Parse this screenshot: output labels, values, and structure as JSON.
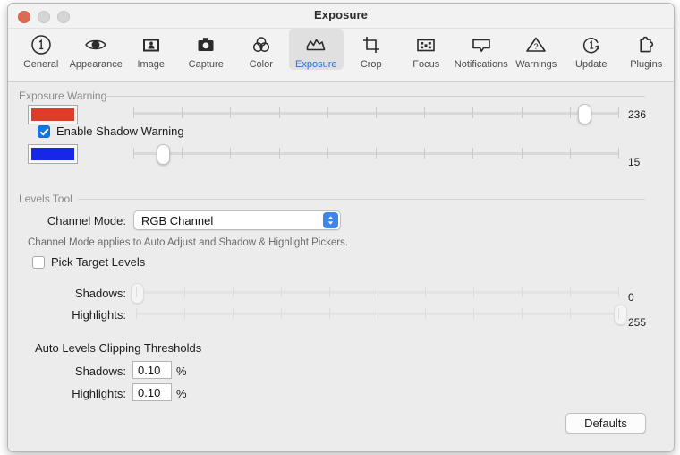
{
  "window": {
    "title": "Exposure",
    "controls": [
      {
        "name": "close",
        "label": "Close"
      },
      {
        "name": "minimize",
        "label": "Minimize"
      },
      {
        "name": "zoom",
        "label": "Zoom"
      }
    ]
  },
  "toolbar": {
    "selected": "Exposure",
    "items": [
      {
        "label": "General",
        "icon": "circled-one-icon"
      },
      {
        "label": "Appearance",
        "icon": "eye-icon"
      },
      {
        "label": "Image",
        "icon": "picture-frame-icon"
      },
      {
        "label": "Capture",
        "icon": "camera-icon"
      },
      {
        "label": "Color",
        "icon": "color-circles-icon"
      },
      {
        "label": "Exposure",
        "icon": "histogram-icon"
      },
      {
        "label": "Crop",
        "icon": "crop-icon"
      },
      {
        "label": "Focus",
        "icon": "focus-grid-icon"
      },
      {
        "label": "Notifications",
        "icon": "speech-bubble-icon"
      },
      {
        "label": "Warnings",
        "icon": "warning-triangle-icon"
      },
      {
        "label": "Update",
        "icon": "refresh-one-icon"
      },
      {
        "label": "Plugins",
        "icon": "puzzle-piece-icon"
      }
    ]
  },
  "exposure_warning": {
    "group_title": "Exposure Warning",
    "highlight_color": "#dc3c28",
    "highlight_slider": {
      "value": 236,
      "min": 0,
      "max": 255,
      "ticks": 11,
      "enabled": true
    },
    "shadow_checkbox": {
      "label": "Enable Shadow Warning",
      "checked": true
    },
    "shadow_color": "#1528e8",
    "shadow_slider": {
      "value": 15,
      "min": 0,
      "max": 255,
      "ticks": 11,
      "enabled": true
    }
  },
  "levels_tool": {
    "group_title": "Levels Tool",
    "channel_mode_label": "Channel Mode:",
    "channel_mode_value": "RGB Channel",
    "channel_mode_options": [
      "RGB Channel"
    ],
    "note": "Channel Mode applies to Auto Adjust and Shadow & Highlight Pickers.",
    "pick_target_levels": {
      "label": "Pick Target Levels",
      "checked": false
    },
    "shadows_label": "Shadows:",
    "shadows_slider": {
      "value": 0,
      "min": 0,
      "max": 255,
      "ticks": 11,
      "enabled": false
    },
    "shadows_value_text": "0",
    "highlights_label": "Highlights:",
    "highlights_slider": {
      "value": 255,
      "min": 0,
      "max": 255,
      "ticks": 11,
      "enabled": false
    },
    "highlights_value_text": "255"
  },
  "auto_levels": {
    "group_title": "Auto Levels Clipping Thresholds",
    "shadows_label": "Shadows:",
    "shadows_value": "0.10",
    "shadows_unit": "%",
    "highlights_label": "Highlights:",
    "highlights_value": "0.10",
    "highlights_unit": "%"
  },
  "footer": {
    "defaults_label": "Defaults"
  }
}
